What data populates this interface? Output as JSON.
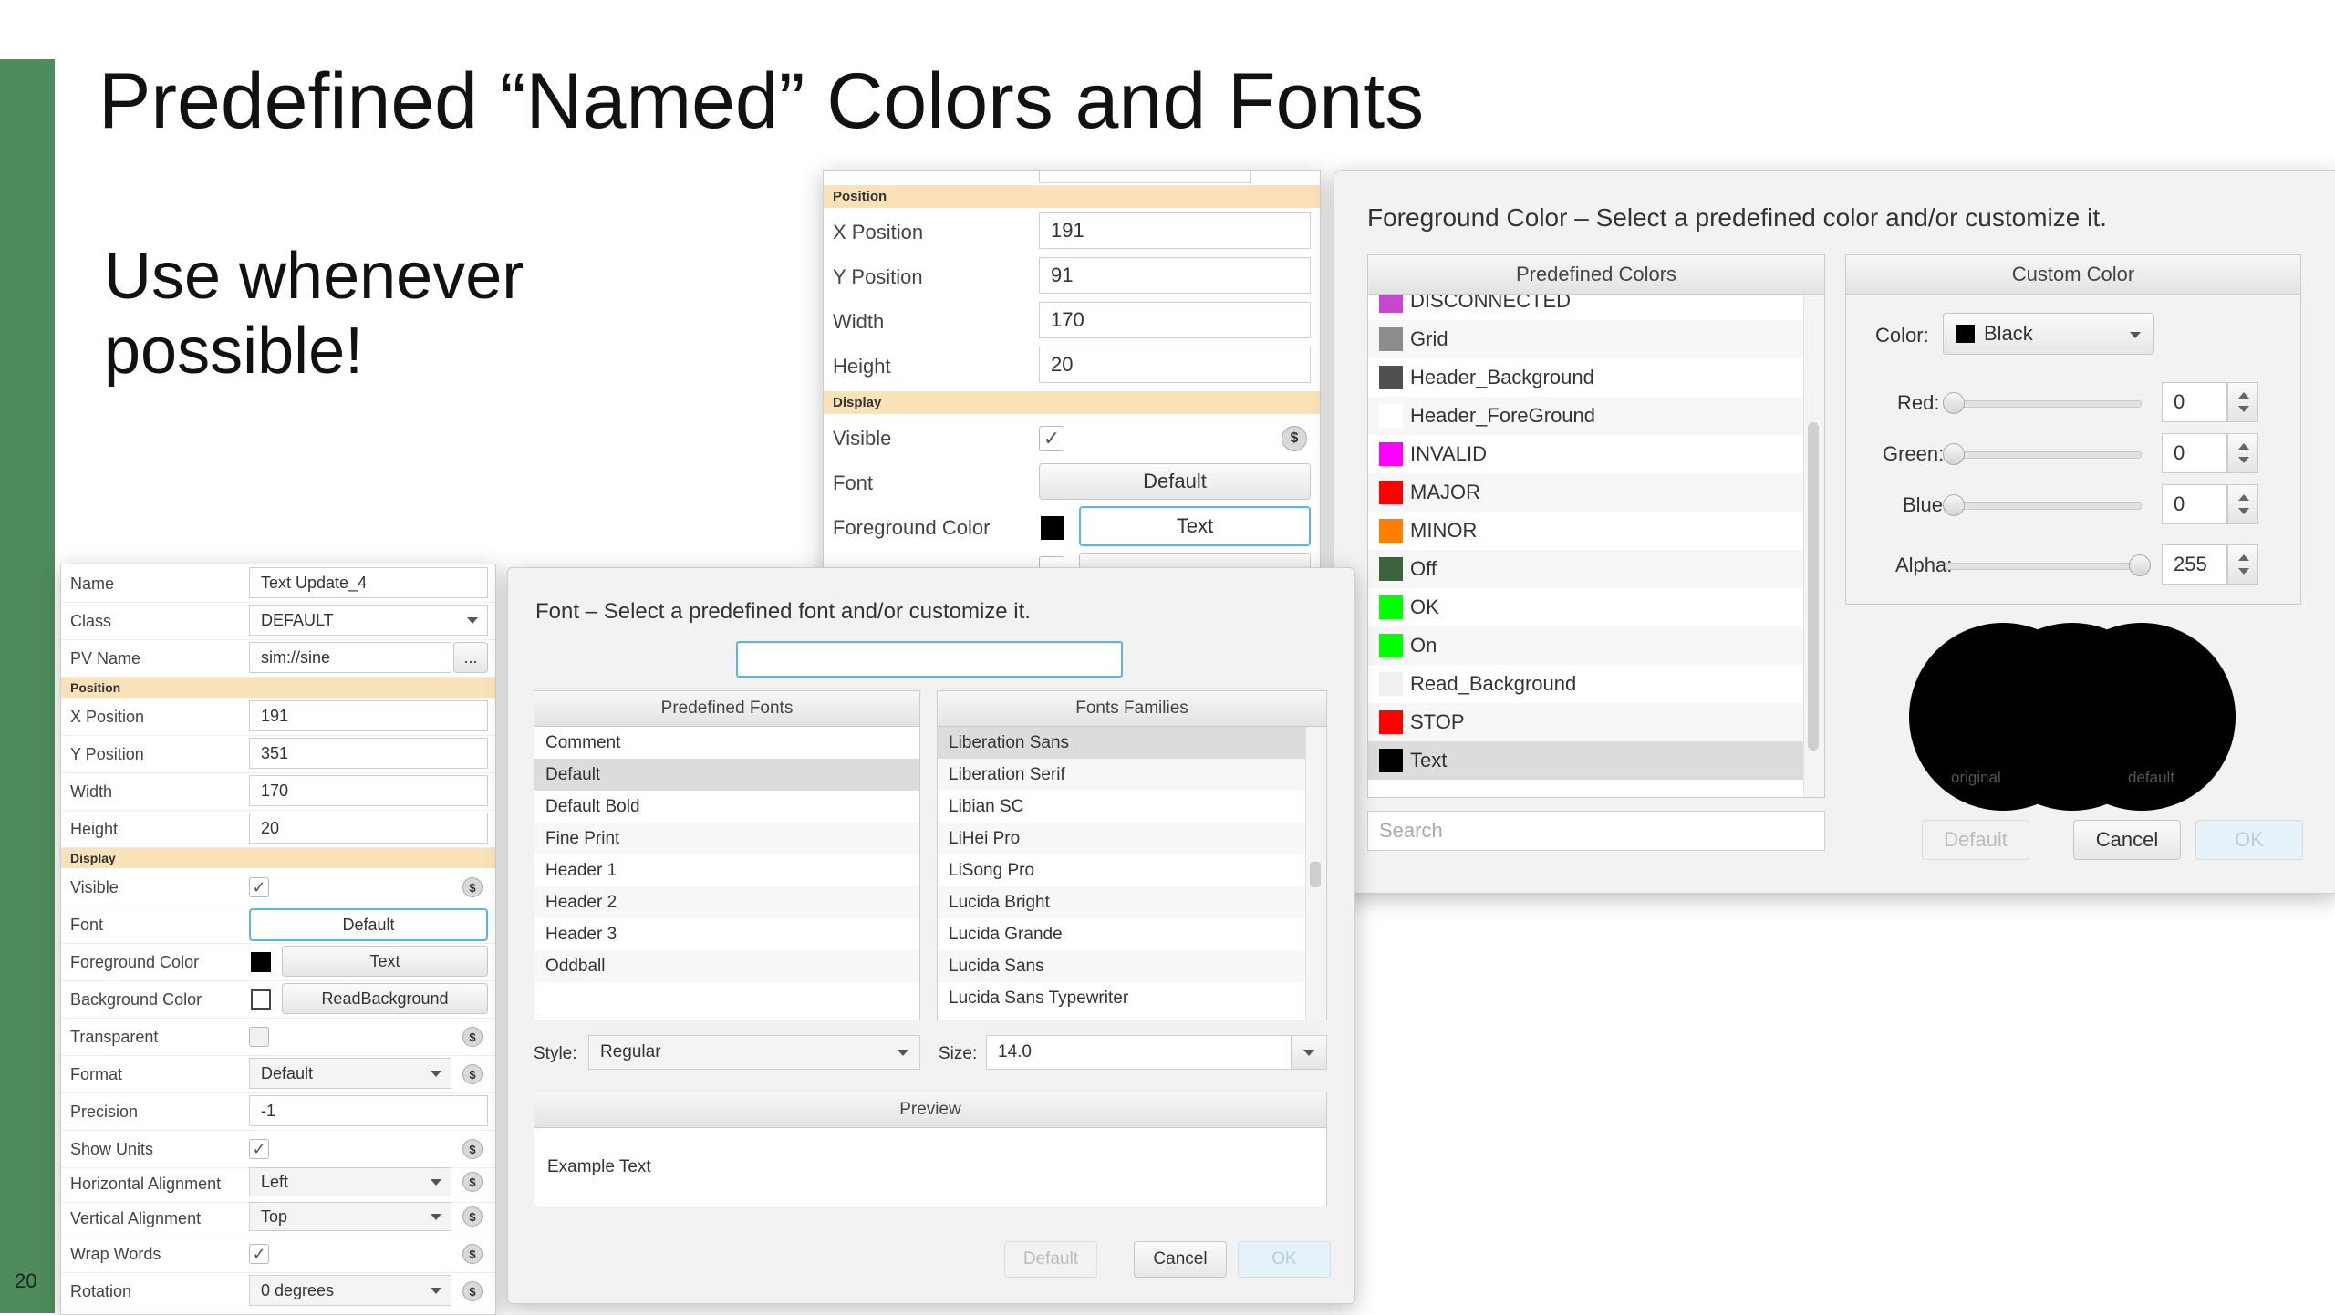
{
  "slide": {
    "title": "Predefined “Named” Colors and Fonts",
    "subtitle": "Use whenever possible!",
    "page_number": "20"
  },
  "property_panel_main": {
    "name_label": "Name",
    "name_value": "Text Update_4",
    "class_label": "Class",
    "class_value": "DEFAULT",
    "pv_label": "PV Name",
    "pv_value": "sim://sine",
    "pv_button": "...",
    "position_section": "Position",
    "x_label": "X Position",
    "x_value": "191",
    "y_label": "Y Position",
    "y_value": "351",
    "width_label": "Width",
    "width_value": "170",
    "height_label": "Height",
    "height_value": "20",
    "display_section": "Display",
    "visible_label": "Visible",
    "visible_check": "✓",
    "font_label": "Font",
    "font_value": "Default",
    "fg_label": "Foreground Color",
    "fg_value": "Text",
    "bg_label": "Background Color",
    "bg_value": "ReadBackground",
    "transparent_label": "Transparent",
    "format_label": "Format",
    "format_value": "Default",
    "precision_label": "Precision",
    "precision_value": "-1",
    "units_label": "Show Units",
    "units_check": "✓",
    "halign_label": "Horizontal Alignment",
    "halign_value": "Left",
    "valign_label": "Vertical Alignment",
    "valign_value": "Top",
    "wrap_label": "Wrap Words",
    "wrap_check": "✓",
    "rotation_label": "Rotation",
    "rotation_value": "0 degrees",
    "rule_symbol": "$"
  },
  "property_panel_upper": {
    "position_section": "Position",
    "x_label": "X Position",
    "x_value": "191",
    "y_label": "Y Position",
    "y_value": "91",
    "width_label": "Width",
    "width_value": "170",
    "height_label": "Height",
    "height_value": "20",
    "display_section": "Display",
    "visible_label": "Visible",
    "visible_check": "✓",
    "font_label": "Font",
    "font_value": "Default",
    "fg_label": "Foreground Color",
    "fg_value": "Text",
    "rule_symbol": "$"
  },
  "font_dialog": {
    "title": "Font – Select a predefined font and/or customize it.",
    "search_value": "",
    "predefined_header": "Predefined Fonts",
    "predefined_fonts": [
      "Comment",
      "Default",
      "Default Bold",
      "Fine Print",
      "Header 1",
      "Header 2",
      "Header 3",
      "Oddball"
    ],
    "families_header": "Fonts Families",
    "families": [
      "Liberation Sans",
      "Liberation Serif",
      "Libian SC",
      "LiHei Pro",
      "LiSong Pro",
      "Lucida Bright",
      "Lucida Grande",
      "Lucida Sans",
      "Lucida Sans Typewriter"
    ],
    "style_label": "Style:",
    "style_value": "Regular",
    "size_label": "Size:",
    "size_value": "14.0",
    "preview_header": "Preview",
    "preview_text": "Example Text",
    "default_button": "Default",
    "cancel_button": "Cancel",
    "ok_button": "OK"
  },
  "color_dialog": {
    "title": "Foreground Color – Select a predefined color and/or customize it.",
    "predefined_header": "Predefined Colors",
    "colors": [
      {
        "name": "DISCONNECTED",
        "color": "#c846d2"
      },
      {
        "name": "Grid",
        "color": "#8c8c8c"
      },
      {
        "name": "Header_Background",
        "color": "#505050"
      },
      {
        "name": "Header_ForeGround",
        "color": "#ffffff"
      },
      {
        "name": "INVALID",
        "color": "#ff00ff"
      },
      {
        "name": "MAJOR",
        "color": "#ff0000"
      },
      {
        "name": "MINOR",
        "color": "#ff8000"
      },
      {
        "name": "Off",
        "color": "#3c643c"
      },
      {
        "name": "OK",
        "color": "#00ff00"
      },
      {
        "name": "On",
        "color": "#00ff00"
      },
      {
        "name": "Read_Background",
        "color": "#f0f0f0"
      },
      {
        "name": "STOP",
        "color": "#ff0000"
      },
      {
        "name": "Text",
        "color": "#000000"
      }
    ],
    "search_placeholder": "Search",
    "custom_header": "Custom Color",
    "color_label": "Color:",
    "color_value": "Black",
    "red_label": "Red:",
    "red_value": "0",
    "green_label": "Green:",
    "green_value": "0",
    "blue_label": "Blue:",
    "blue_value": "0",
    "alpha_label": "Alpha:",
    "alpha_value": "255",
    "original_label": "original",
    "default_label": "default",
    "default_button": "Default",
    "cancel_button": "Cancel",
    "ok_button": "OK"
  },
  "colors": {
    "accent_green": "#4f8c5b",
    "section_bg": "#fae2b8",
    "focus_blue": "#58b6e6"
  }
}
